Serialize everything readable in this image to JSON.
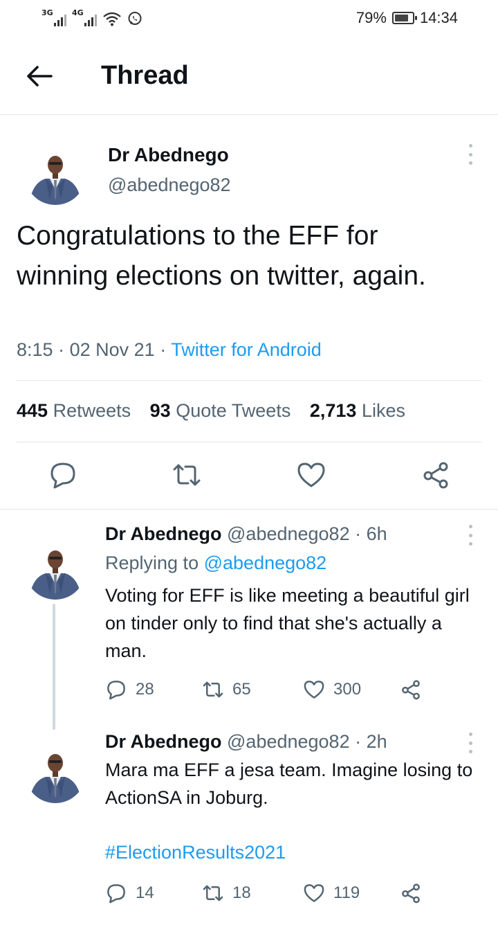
{
  "status_bar": {
    "signal1_label": "3G",
    "signal2_label": "4G",
    "battery": "79%",
    "battery_level": 0.79,
    "time": "14:34"
  },
  "header": {
    "title": "Thread",
    "back_icon": "arrow-left-icon"
  },
  "main_tweet": {
    "name": "Dr Abednego",
    "handle": "@abednego82",
    "text": "Congratulations to the EFF for winning elections on twitter, again.",
    "time": "8:15",
    "date": "02 Nov 21",
    "source": "Twitter for Android",
    "stats": {
      "retweets_count": "445",
      "retweets_label": "Retweets",
      "quotes_count": "93",
      "quotes_label": "Quote Tweets",
      "likes_count": "2,713",
      "likes_label": "Likes"
    }
  },
  "replies": [
    {
      "name": "Dr Abednego",
      "handle": "@abednego82",
      "age": "6h",
      "replying_prefix": "Replying to",
      "replying_to": "@abednego82",
      "text": "Voting for EFF is like meeting a beautiful girl on tinder only to find that she's actually a man.",
      "replies": "28",
      "retweets": "65",
      "likes": "300"
    },
    {
      "name": "Dr Abednego",
      "handle": "@abednego82",
      "age": "2h",
      "text": "Mara ma EFF a jesa team. Imagine losing to ActionSA in Joburg.",
      "hashtag": "#ElectionResults2021",
      "replies": "14",
      "retweets": "18",
      "likes": "119"
    }
  ],
  "colors": {
    "accent": "#1d9bf0",
    "text": "#0f1419",
    "secondary": "#536471",
    "divider": "#e6e6e6"
  }
}
